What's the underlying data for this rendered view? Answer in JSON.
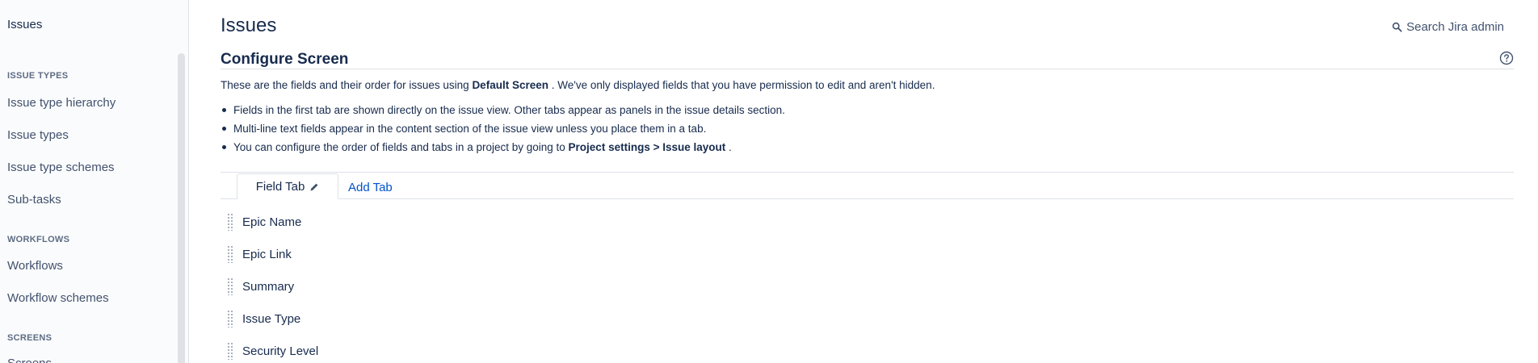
{
  "sidebar": {
    "header": "Issues",
    "sections": [
      {
        "title": "ISSUE TYPES",
        "items": [
          "Issue type hierarchy",
          "Issue types",
          "Issue type schemes",
          "Sub-tasks"
        ]
      },
      {
        "title": "WORKFLOWS",
        "items": [
          "Workflows",
          "Workflow schemes"
        ]
      },
      {
        "title": "SCREENS",
        "items": [
          "Screens"
        ]
      }
    ]
  },
  "header": {
    "title": "Issues",
    "search_label": "Search Jira admin"
  },
  "configure": {
    "title": "Configure Screen",
    "description_prefix": "These are the fields and their order for issues using",
    "description_screen": "Default Screen",
    "description_suffix": ". We've only displayed fields that you have permission to edit and aren't hidden.",
    "bullet_1": "Fields in the first tab are shown directly on the issue view. Other tabs appear as panels in the issue details section.",
    "bullet_2": "Multi-line text fields appear in the content section of the issue view unless you place them in a tab.",
    "bullet_3_prefix": "You can configure the order of fields and tabs in a project by going to",
    "bullet_3_bold": "Project settings > Issue layout",
    "bullet_3_suffix": "."
  },
  "tabs": {
    "active": "Field Tab",
    "add": "Add Tab"
  },
  "fields": [
    "Epic Name",
    "Epic Link",
    "Summary",
    "Issue Type",
    "Security Level"
  ],
  "colors": {
    "link": "#0052cc",
    "text": "#172b4d",
    "sidebar_bg": "#fafbfc"
  }
}
